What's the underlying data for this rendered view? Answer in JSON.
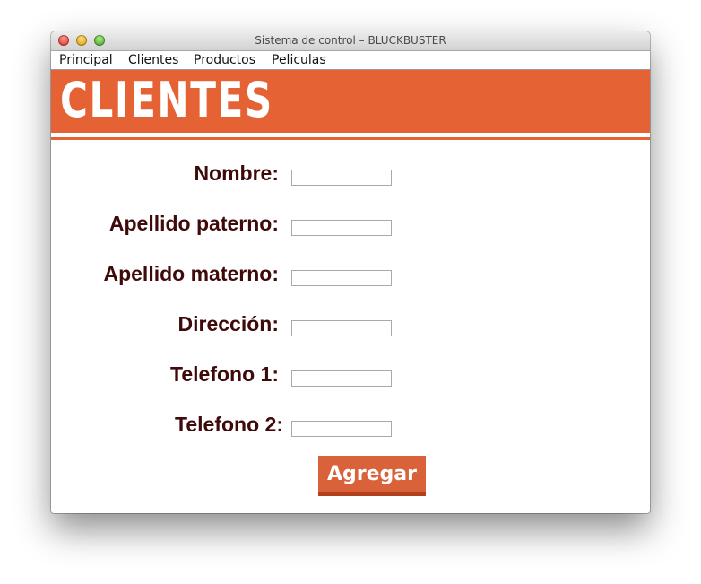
{
  "window": {
    "title": "Sistema de control – BLUCKBUSTER"
  },
  "menu": {
    "items": [
      {
        "label": "Principal"
      },
      {
        "label": "Clientes"
      },
      {
        "label": "Productos"
      },
      {
        "label": "Peliculas"
      }
    ]
  },
  "banner": {
    "title": "CLIENTES",
    "color": "#e56235"
  },
  "form": {
    "fields": [
      {
        "label": "Nombre:",
        "value": ""
      },
      {
        "label": "Apellido paterno:",
        "value": ""
      },
      {
        "label": "Apellido materno:",
        "value": ""
      },
      {
        "label": "Dirección:",
        "value": ""
      },
      {
        "label": "Telefono 1:",
        "value": ""
      },
      {
        "label": "Telefono 2:",
        "value": ""
      }
    ],
    "submit_label": "Agregar",
    "label_color": "#3e0a0a",
    "button_color": "#d9623a"
  }
}
